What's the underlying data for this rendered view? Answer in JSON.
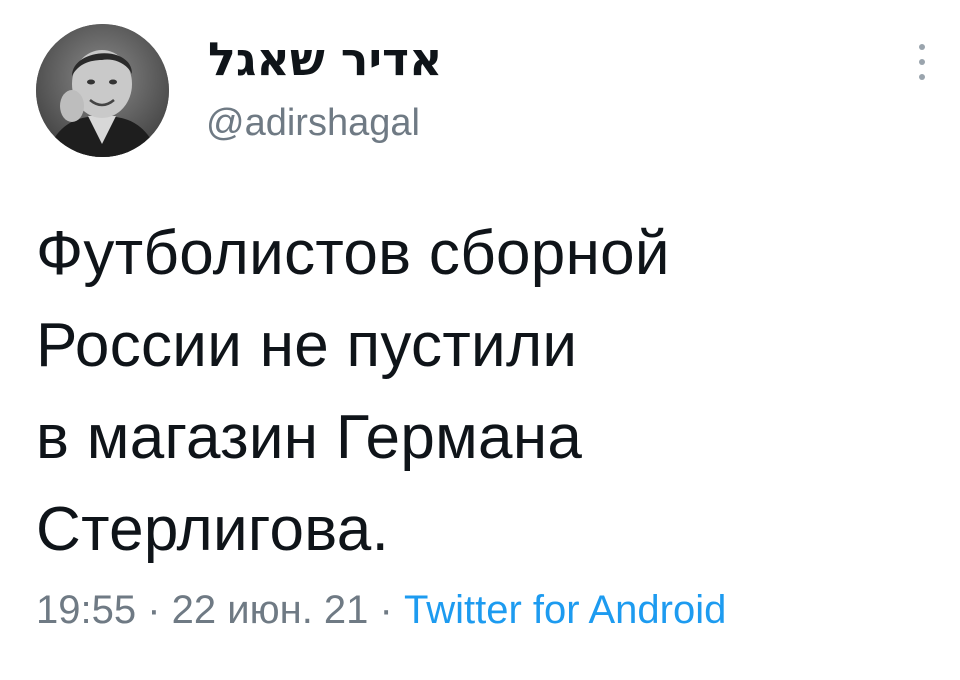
{
  "tweet": {
    "author": {
      "display_name": "אדיר שאגל",
      "handle": "@adirshagal"
    },
    "text": "Футболистов сборной\nРоссии не пустили\nв магазин Германа\nСтерлигова.",
    "time": "19:55",
    "separator": " · ",
    "date": "22 июн. 21",
    "source": "Twitter for Android",
    "icons": {
      "avatar": "user-avatar-photo",
      "more": "more-options-icon"
    },
    "colors": {
      "text": "#0f1419",
      "muted": "#6f7a84",
      "link": "#1d9bf0"
    }
  }
}
